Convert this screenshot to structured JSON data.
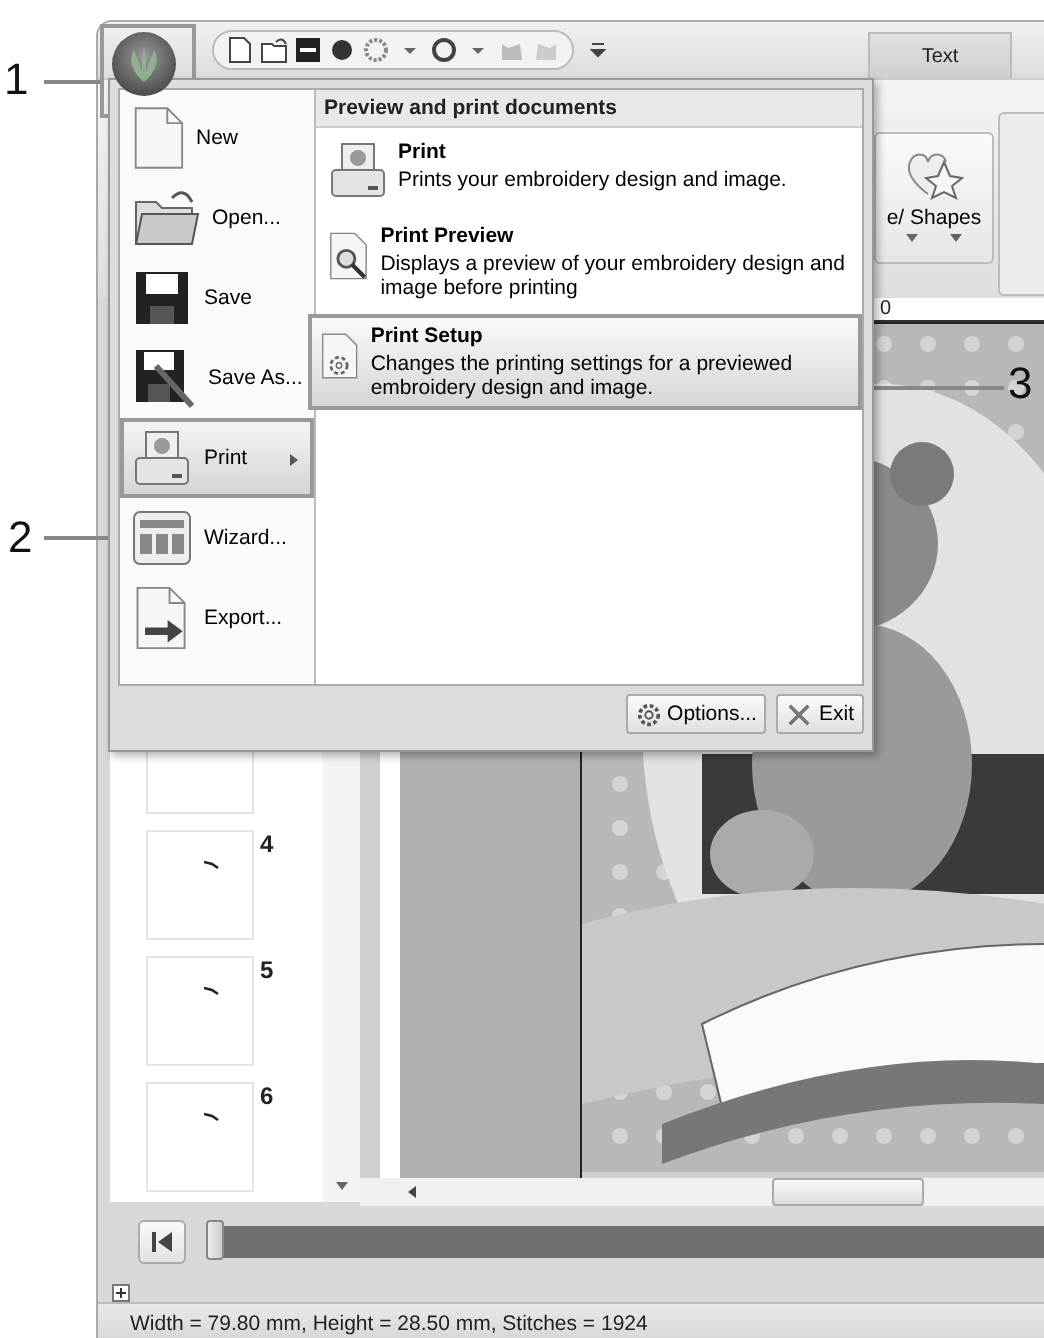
{
  "callouts": [
    {
      "label": "1"
    },
    {
      "label": "2"
    },
    {
      "label": "3"
    }
  ],
  "ribbon": {
    "tab": {
      "label": "Text",
      "selected": false
    },
    "button": {
      "label": "e/ Shapes"
    }
  },
  "app_menu": {
    "items": [
      {
        "label": "New",
        "selected": false,
        "submenu": false
      },
      {
        "label": "Open...",
        "selected": false,
        "submenu": false
      },
      {
        "label": "Save",
        "selected": false,
        "submenu": false
      },
      {
        "label": "Save As...",
        "selected": false,
        "submenu": false
      },
      {
        "label": "Print",
        "selected": true,
        "submenu": true
      },
      {
        "label": "Wizard...",
        "selected": false,
        "submenu": false
      },
      {
        "label": "Export...",
        "selected": false,
        "submenu": false
      }
    ],
    "pane": {
      "title": "Preview and print documents",
      "items": [
        {
          "title": "Print",
          "description": "Prints your embroidery design and image.",
          "selected": false
        },
        {
          "title": "Print Preview",
          "description": "Displays a preview of your embroidery design and image before printing",
          "selected": false
        },
        {
          "title": "Print Setup",
          "description": "Changes the printing settings for a previewed embroidery design and image.",
          "selected": true
        }
      ]
    },
    "buttons": [
      {
        "label": "Options..."
      },
      {
        "label": "Exit"
      }
    ]
  },
  "ruler": {
    "label": "0"
  },
  "thumbnails": [
    {
      "number": "4"
    },
    {
      "number": "5"
    },
    {
      "number": "6"
    }
  ],
  "slider": {
    "level": 0
  },
  "status_bar": "Width = 79.80 mm, Height = 28.50 mm, Stitches = 1924"
}
